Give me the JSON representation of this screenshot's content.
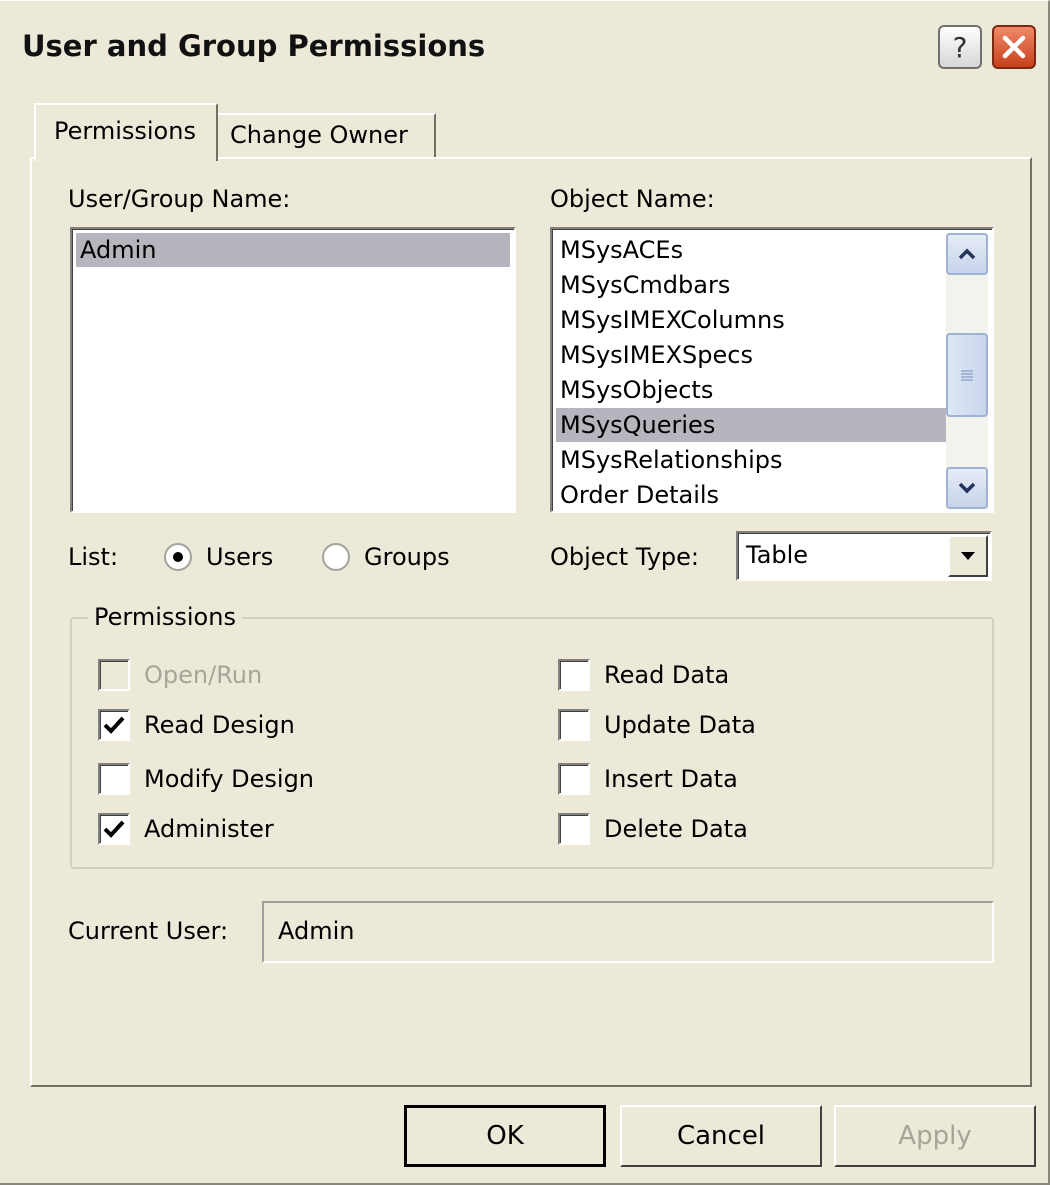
{
  "window": {
    "title": "User and Group Permissions",
    "help_glyph": "?",
    "colors": {
      "face": "#ece9d8",
      "selection": "#b6b5bd",
      "close": "#c8401b"
    }
  },
  "tabs": [
    {
      "label": "Permissions",
      "active": true
    },
    {
      "label": "Change Owner",
      "active": false
    }
  ],
  "user_group": {
    "label": "User/Group Name:",
    "items": [
      "Admin"
    ],
    "selected": "Admin"
  },
  "object_list": {
    "label": "Object Name:",
    "items": [
      "MSysACEs",
      "MSysCmdbars",
      "MSysIMEXColumns",
      "MSysIMEXSpecs",
      "MSysObjects",
      "MSysQueries",
      "MSysRelationships",
      "Order Details"
    ],
    "selected": "MSysQueries"
  },
  "list_filter": {
    "label": "List:",
    "options": [
      {
        "label": "Users",
        "selected": true
      },
      {
        "label": "Groups",
        "selected": false
      }
    ]
  },
  "object_type": {
    "label": "Object Type:",
    "value": "Table"
  },
  "permissions": {
    "legend": "Permissions",
    "left": [
      {
        "label": "Open/Run",
        "checked": false,
        "enabled": false
      },
      {
        "label": "Read Design",
        "checked": true,
        "enabled": true
      },
      {
        "label": "Modify Design",
        "checked": false,
        "enabled": true
      },
      {
        "label": "Administer",
        "checked": true,
        "enabled": true
      }
    ],
    "right": [
      {
        "label": "Read Data",
        "checked": false,
        "enabled": true
      },
      {
        "label": "Update Data",
        "checked": false,
        "enabled": true
      },
      {
        "label": "Insert Data",
        "checked": false,
        "enabled": true
      },
      {
        "label": "Delete Data",
        "checked": false,
        "enabled": true
      }
    ]
  },
  "current_user": {
    "label": "Current User:",
    "value": "Admin"
  },
  "buttons": {
    "ok": "OK",
    "cancel": "Cancel",
    "apply": "Apply"
  },
  "icons": {
    "close": "close-x-icon",
    "help": "help-question-icon",
    "scroll_up": "chevron-up-icon",
    "scroll_down": "chevron-down-icon",
    "dropdown": "triangle-down-icon",
    "check": "checkmark-icon"
  }
}
